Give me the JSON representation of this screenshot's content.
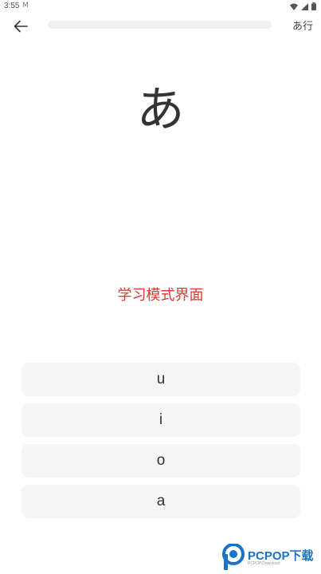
{
  "status_bar": {
    "time": "3:55",
    "mail_glyph": "M",
    "icons": [
      "wifi-icon",
      "signal-icon",
      "battery-icon"
    ]
  },
  "app_bar": {
    "back_icon": "arrow-left-icon",
    "progress": 0.0,
    "row_label": "あ行"
  },
  "card": {
    "kana": "あ",
    "mode_label": "学习模式界面"
  },
  "options": [
    {
      "label": "u"
    },
    {
      "label": "i"
    },
    {
      "label": "o"
    },
    {
      "label": "a"
    }
  ],
  "watermark": {
    "brand": "PCPOP下载",
    "sub": "PCPOP.Download"
  },
  "colors": {
    "accent_red": "#d83a2e",
    "option_bg": "#f6f6f6",
    "brand_blue": "#1a73c9"
  }
}
